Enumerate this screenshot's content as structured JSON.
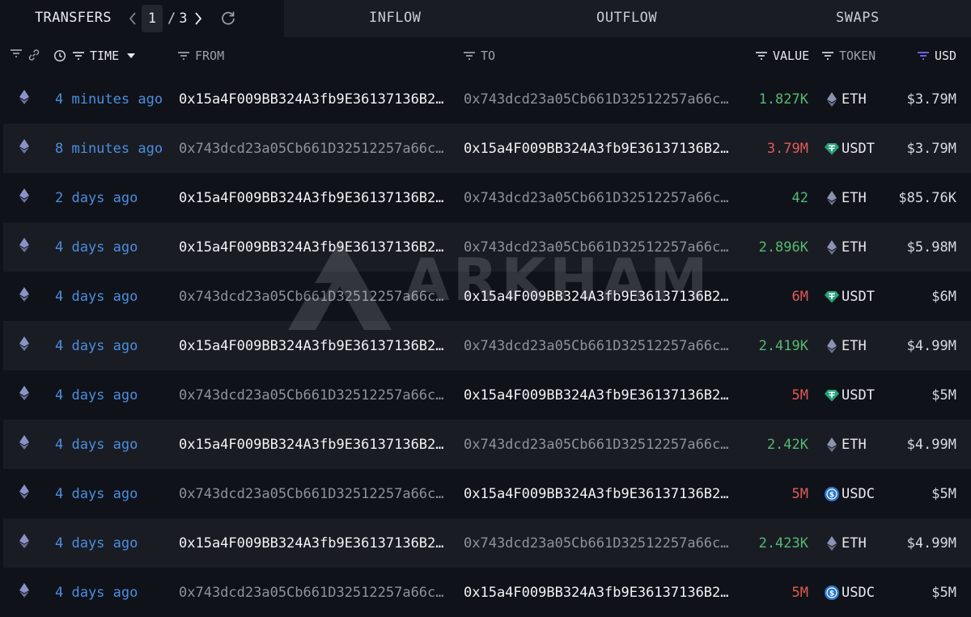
{
  "header": {
    "title": "TRANSFERS",
    "page_current": "1",
    "page_sep": "/",
    "page_total": "3",
    "tabs": [
      "INFLOW",
      "OUTFLOW",
      "SWAPS"
    ]
  },
  "columns": {
    "time": "TIME",
    "from": "FROM",
    "to": "TO",
    "value": "VALUE",
    "token": "TOKEN",
    "usd": "USD"
  },
  "watermark": "ARKHAM",
  "colors": {
    "time_link": "#4a8ee0",
    "value_in": "#56b973",
    "value_out": "#e05b57",
    "usdt": "#26a17b",
    "usdc": "#2775ca",
    "eth": "#8a93b2"
  },
  "rows": [
    {
      "time": "4 minutes ago",
      "from": "0x15a4F009BB324A3fb9E36137136B2…",
      "to": "0x743dcd23a05Cb661D32512257a66c…",
      "direction": "in",
      "value": "1.827K",
      "token": "ETH",
      "usd": "$3.79M"
    },
    {
      "time": "8 minutes ago",
      "from": "0x743dcd23a05Cb661D32512257a66c…",
      "to": "0x15a4F009BB324A3fb9E36137136B2…",
      "direction": "out",
      "value": "3.79M",
      "token": "USDT",
      "usd": "$3.79M"
    },
    {
      "time": "2 days ago",
      "from": "0x15a4F009BB324A3fb9E36137136B2…",
      "to": "0x743dcd23a05Cb661D32512257a66c…",
      "direction": "in",
      "value": "42",
      "token": "ETH",
      "usd": "$85.76K"
    },
    {
      "time": "4 days ago",
      "from": "0x15a4F009BB324A3fb9E36137136B2…",
      "to": "0x743dcd23a05Cb661D32512257a66c…",
      "direction": "in",
      "value": "2.896K",
      "token": "ETH",
      "usd": "$5.98M"
    },
    {
      "time": "4 days ago",
      "from": "0x743dcd23a05Cb661D32512257a66c…",
      "to": "0x15a4F009BB324A3fb9E36137136B2…",
      "direction": "out",
      "value": "6M",
      "token": "USDT",
      "usd": "$6M"
    },
    {
      "time": "4 days ago",
      "from": "0x15a4F009BB324A3fb9E36137136B2…",
      "to": "0x743dcd23a05Cb661D32512257a66c…",
      "direction": "in",
      "value": "2.419K",
      "token": "ETH",
      "usd": "$4.99M"
    },
    {
      "time": "4 days ago",
      "from": "0x743dcd23a05Cb661D32512257a66c…",
      "to": "0x15a4F009BB324A3fb9E36137136B2…",
      "direction": "out",
      "value": "5M",
      "token": "USDT",
      "usd": "$5M"
    },
    {
      "time": "4 days ago",
      "from": "0x15a4F009BB324A3fb9E36137136B2…",
      "to": "0x743dcd23a05Cb661D32512257a66c…",
      "direction": "in",
      "value": "2.42K",
      "token": "ETH",
      "usd": "$4.99M"
    },
    {
      "time": "4 days ago",
      "from": "0x743dcd23a05Cb661D32512257a66c…",
      "to": "0x15a4F009BB324A3fb9E36137136B2…",
      "direction": "out",
      "value": "5M",
      "token": "USDC",
      "usd": "$5M"
    },
    {
      "time": "4 days ago",
      "from": "0x15a4F009BB324A3fb9E36137136B2…",
      "to": "0x743dcd23a05Cb661D32512257a66c…",
      "direction": "in",
      "value": "2.423K",
      "token": "ETH",
      "usd": "$4.99M"
    },
    {
      "time": "4 days ago",
      "from": "0x743dcd23a05Cb661D32512257a66c…",
      "to": "0x15a4F009BB324A3fb9E36137136B2…",
      "direction": "out",
      "value": "5M",
      "token": "USDC",
      "usd": "$5M"
    }
  ]
}
